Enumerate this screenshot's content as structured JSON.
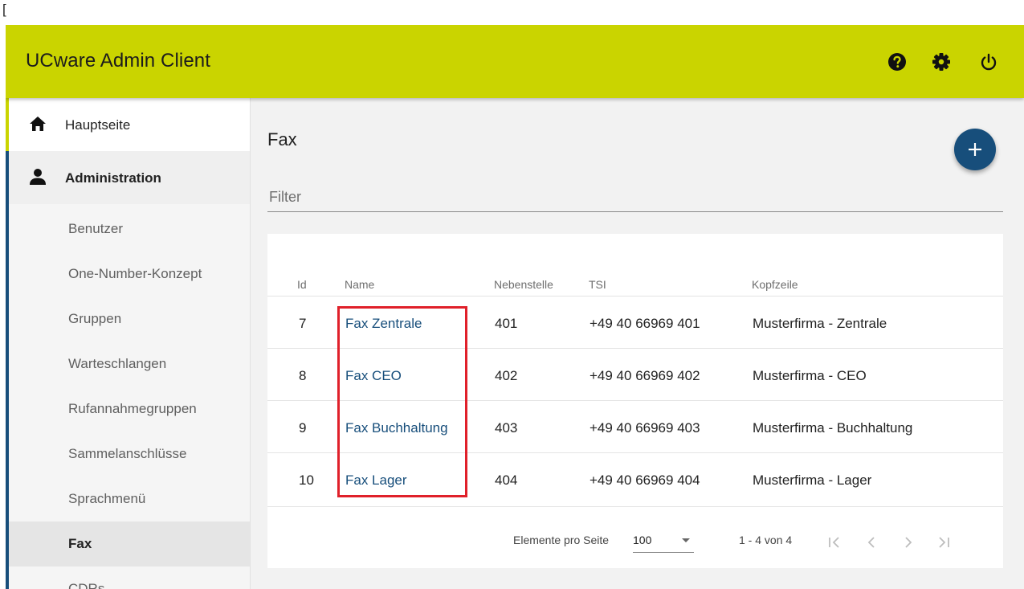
{
  "outer_bracket": "[",
  "app": {
    "title": "UCware Admin Client",
    "header_icons": [
      "help-icon",
      "gear-icon",
      "power-icon"
    ],
    "accent_color": "#cad400",
    "primary_color": "#174e7b"
  },
  "sidebar": {
    "home_label": "Hauptseite",
    "admin_label": "Administration",
    "sub_items": [
      {
        "label": "Benutzer",
        "active": false
      },
      {
        "label": "One-Number-Konzept",
        "active": false
      },
      {
        "label": "Gruppen",
        "active": false
      },
      {
        "label": "Warteschlangen",
        "active": false
      },
      {
        "label": "Rufannahmegruppen",
        "active": false
      },
      {
        "label": "Sammelanschlüsse",
        "active": false
      },
      {
        "label": "Sprachmenü",
        "active": false
      },
      {
        "label": "Fax",
        "active": true
      },
      {
        "label": "CDRs",
        "active": false
      }
    ]
  },
  "main": {
    "title": "Fax",
    "add_button_icon": "plus-icon",
    "filter_placeholder": "Filter"
  },
  "table": {
    "columns": [
      "Id",
      "Name",
      "Nebenstelle",
      "TSI",
      "Kopfzeile"
    ],
    "rows": [
      {
        "id": "7",
        "name": "Fax Zentrale",
        "extension": "401",
        "tsi": "+49 40 66969 401",
        "header": "Musterfirma - Zentrale"
      },
      {
        "id": "8",
        "name": "Fax CEO",
        "extension": "402",
        "tsi": "+49 40 66969 402",
        "header": "Musterfirma - CEO"
      },
      {
        "id": "9",
        "name": "Fax Buchhaltung",
        "extension": "403",
        "tsi": "+49 40 66969 403",
        "header": "Musterfirma - Buchhaltung"
      },
      {
        "id": "10",
        "name": "Fax Lager",
        "extension": "404",
        "tsi": "+49 40 66969 404",
        "header": "Musterfirma - Lager"
      }
    ]
  },
  "paginator": {
    "items_per_page_label": "Elemente pro Seite",
    "items_per_page_value": "100",
    "range_label": "1 - 4 von 4"
  }
}
